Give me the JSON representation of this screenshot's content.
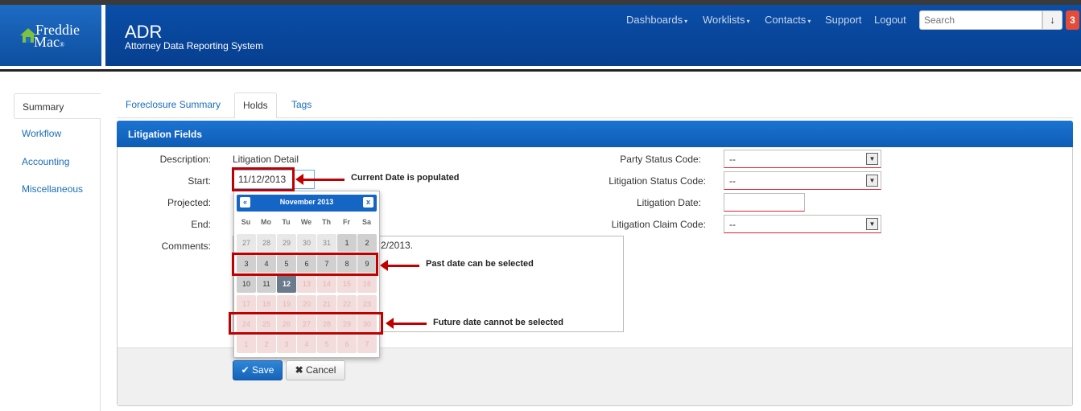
{
  "header": {
    "logo_line1": "Freddie",
    "logo_line2": "Mac",
    "app_title": "ADR",
    "app_subtitle": "Attorney Data Reporting System",
    "nav": [
      "Dashboards",
      "Worklists",
      "Contacts",
      "Support",
      "Logout"
    ],
    "search_placeholder": "Search",
    "notification_count": "3"
  },
  "sidebar": {
    "items": [
      "Summary",
      "Workflow",
      "Accounting",
      "Miscellaneous"
    ]
  },
  "tabs": [
    "Foreclosure Summary",
    "Holds",
    "Tags"
  ],
  "panel": {
    "title": "Litigation Fields",
    "labels": {
      "description": "Description:",
      "start": "Start:",
      "projected": "Projected:",
      "end": "End:",
      "comments": "Comments:",
      "party_status": "Party Status Code:",
      "litigation_status": "Litigation Status Code:",
      "litigation_date": "Litigation Date:",
      "claim_code": "Litigation Claim Code:"
    },
    "description_value": "Litigation Detail",
    "start_value": "11/12/2013",
    "comments_visible_text": "2/2013.",
    "select_value": "--"
  },
  "datepicker": {
    "month_title": "November 2013",
    "prev": "«",
    "next": "x",
    "dow": [
      "Su",
      "Mo",
      "Tu",
      "We",
      "Th",
      "Fr",
      "Sa"
    ],
    "weeks": [
      [
        "27",
        "28",
        "29",
        "30",
        "31",
        "1",
        "2"
      ],
      [
        "3",
        "4",
        "5",
        "6",
        "7",
        "8",
        "9"
      ],
      [
        "10",
        "11",
        "12",
        "13",
        "14",
        "15",
        "16"
      ],
      [
        "17",
        "18",
        "19",
        "20",
        "21",
        "22",
        "23"
      ],
      [
        "24",
        "25",
        "26",
        "27",
        "28",
        "29",
        "30"
      ],
      [
        "1",
        "2",
        "3",
        "4",
        "5",
        "6",
        "7"
      ]
    ]
  },
  "annotations": {
    "current": "Current Date is populated",
    "past": "Past date can be selected",
    "future": "Future date cannot be selected"
  },
  "buttons": {
    "save": "Save",
    "cancel": "Cancel"
  },
  "colors": {
    "header_blue": "#0a4ea8",
    "annotation_red": "#c00000",
    "save_blue": "#1563b8"
  }
}
